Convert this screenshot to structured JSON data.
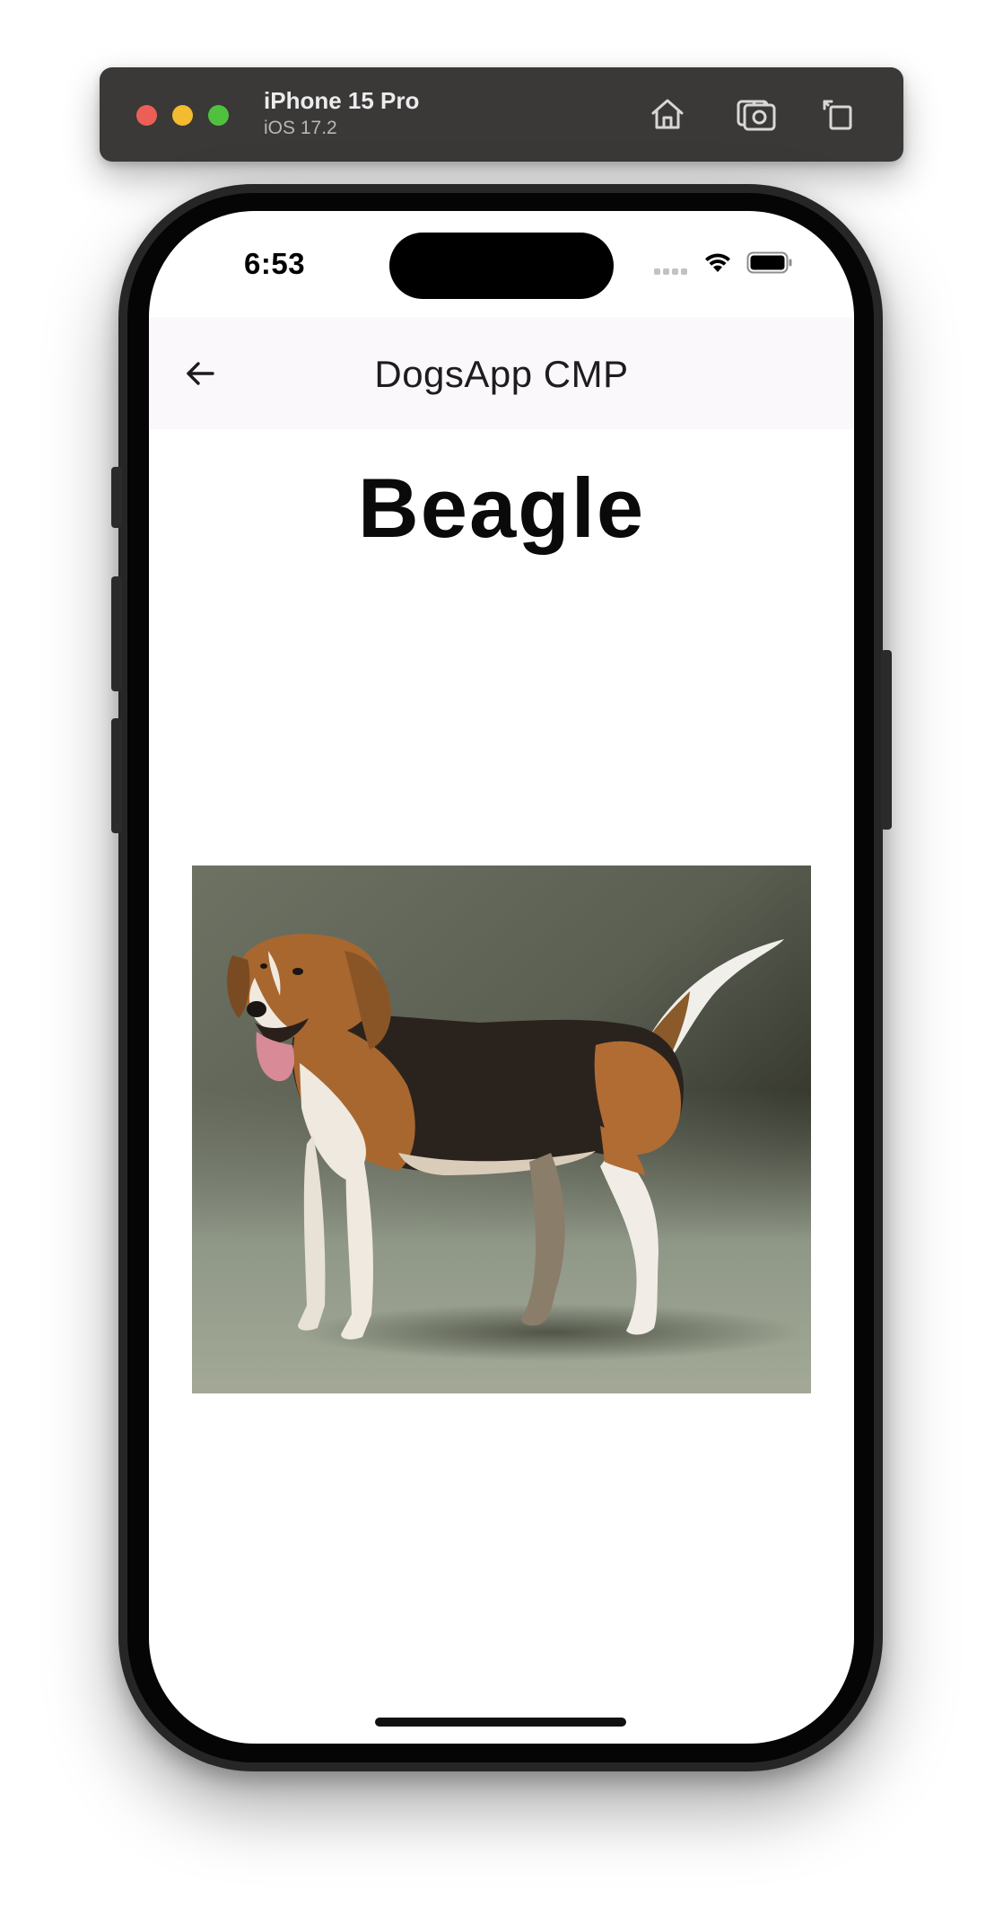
{
  "simulator": {
    "device_name": "iPhone 15 Pro",
    "os_version": "iOS 17.2",
    "toolbar_icons": [
      "home-icon",
      "screenshot-icon",
      "rotate-icon"
    ]
  },
  "status_bar": {
    "time": "6:53",
    "icons": [
      "cellular-signal-icon",
      "wifi-icon",
      "battery-icon"
    ]
  },
  "app_bar": {
    "title": "DogsApp CMP",
    "back_icon": "arrow-left-icon"
  },
  "detail": {
    "breed_name": "Beagle",
    "image_description_icon": "dog-photo"
  },
  "colors": {
    "app_bar_background": "#fbf8fc",
    "toolbar_background": "#3b3838",
    "traffic_red": "#ec5f57",
    "traffic_yellow": "#f2bb30",
    "traffic_green": "#4fc13f"
  }
}
